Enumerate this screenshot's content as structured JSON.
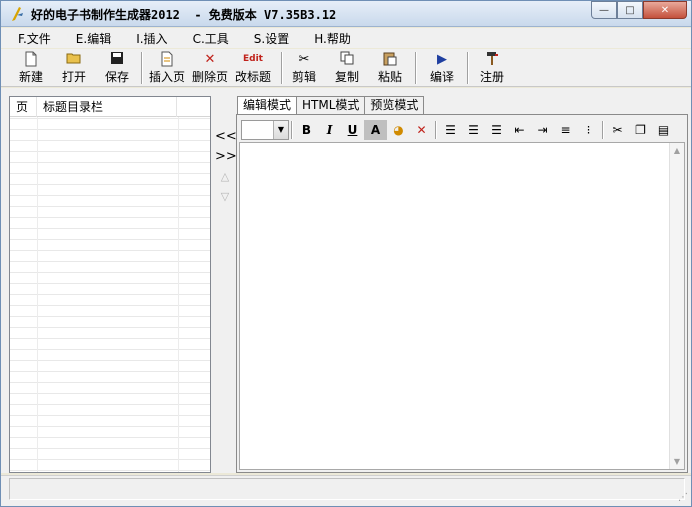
{
  "window": {
    "title": "好的电子书制作生成器2012  - 免费版本 V7.35B3.12",
    "minimize_symbol": "—",
    "maximize_symbol": "□",
    "close_symbol": "✕"
  },
  "menu": [
    "F.文件",
    "E.编辑",
    "I.插入",
    "C.工具",
    "S.设置",
    "H.帮助"
  ],
  "toolbar": {
    "new": "新建",
    "open": "打开",
    "save": "保存",
    "insert_page": "插入页",
    "delete_page": "删除页",
    "rename_title": "改标题",
    "edit_icon_text": "Edit",
    "cut": "剪辑",
    "copy": "复制",
    "paste": "粘贴",
    "compile": "编译",
    "register": "注册"
  },
  "toc": {
    "col_page": "页",
    "col_title": "标题目录栏"
  },
  "arrows": {
    "left": "<<",
    "right": ">>",
    "up": "△",
    "down": "▽"
  },
  "tabs": [
    "编辑模式",
    "HTML模式",
    "预览模式"
  ],
  "format": {
    "bold": "B",
    "italic": "I",
    "underline": "U",
    "font_color": "A"
  }
}
